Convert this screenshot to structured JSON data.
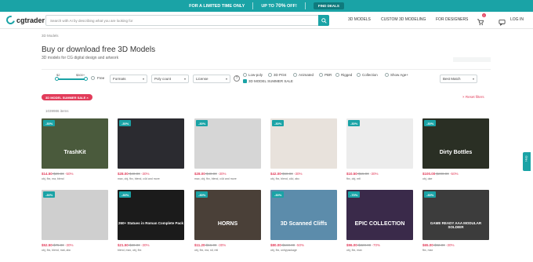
{
  "promo": {
    "limited": "FOR A LIMITED TIME ONLY",
    "upto": "UP TO",
    "pct": "70%",
    "off": "OFF!",
    "find_deals": "FIND DEALS"
  },
  "header": {
    "logo": "cgtrader",
    "search_placeholder": "Search with AI by describing what you are looking for",
    "nav": [
      "3D MODELS",
      "CUSTOM 3D MODELING",
      "FOR DESIGNERS"
    ],
    "cart_count": "0",
    "login": "LOG IN"
  },
  "breadcrumb": "3D Models",
  "title": "Buy or download free 3D Models",
  "subtitle": "3D models for CG digital design and artwork",
  "filters": {
    "price_min": "$2",
    "price_max": "$500+",
    "free": "Free",
    "formats": "Formats",
    "poly_count": "Poly count",
    "license": "License",
    "help": "?",
    "checks_row1": [
      "Low-poly",
      "3D Print",
      "Animated",
      "PBR",
      "Rigged",
      "Collection",
      "Show Age+"
    ],
    "summer_sale": "3D MODEL SUMMER SALE",
    "sort": "Best Match"
  },
  "chip": "3D MODEL SUMMER SALE ×",
  "reset": "× Reset filters",
  "count": "1039986 items",
  "colors": {
    "accent": "#1aa3a6",
    "sale": "#e23c5a"
  },
  "cards": [
    {
      "disc": "-30%",
      "title": "TrashKit",
      "price": "$14.50",
      "old": "$29.00",
      "pct": "-50%",
      "formats": "obj, fbx, ma, blend",
      "color": "#4a5a3c"
    },
    {
      "disc": "-30%",
      "title": "",
      "price": "$28.00",
      "old": "$40.00",
      "pct": "-30%",
      "formats": "max, obj, fbx, blend, c4d and more",
      "color": "#2b2b30"
    },
    {
      "disc": "-30%",
      "title": "",
      "price": "$28.00",
      "old": "$40.00",
      "pct": "-30%",
      "formats": "max, obj, fbx, blend, c4d and more",
      "color": "#d6d6d6"
    },
    {
      "disc": "-30%",
      "title": "",
      "price": "$42.00",
      "old": "$60.00",
      "pct": "-30%",
      "formats": "obj, fbx, blend, c4d, abc",
      "color": "#e8e2dc"
    },
    {
      "disc": "-30%",
      "title": "",
      "price": "$10.50",
      "old": "$15.00",
      "pct": "-30%",
      "formats": "fbx, obj, mtl",
      "color": "#ececec"
    },
    {
      "disc": "-30%",
      "title": "Dirty Bottles",
      "price": "$100.00",
      "old": "$200.00",
      "pct": "-50%",
      "formats": "obj, dae",
      "color": "#2a2f24"
    },
    {
      "disc": "-30%",
      "title": "",
      "price": "$52.50",
      "old": "$75.00",
      "pct": "-30%",
      "formats": "obj, fbx, blend, mat, abc",
      "color": "#cfcfcf"
    },
    {
      "disc": "-30%",
      "title": "260+ Statues in Roman Complete Pack",
      "price": "$21.50",
      "old": "$30.00",
      "pct": "-30%",
      "formats": "blend, max, obj, fbx",
      "color": "#1b1b1b"
    },
    {
      "disc": "-30%",
      "title": "HORNS",
      "price": "$11.20",
      "old": "$16.00",
      "pct": "-30%",
      "formats": "obj, fbx, ma, stl, mtl",
      "color": "#4a4038"
    },
    {
      "disc": "-30%",
      "title": "3D Scanned Cliffs",
      "price": "$80.00",
      "old": "$160.00",
      "pct": "-50%",
      "formats": "obj, fbx, unitypackage",
      "color": "#5c8cab"
    },
    {
      "disc": "-70%",
      "title": "EPIC COLLECTION",
      "price": "$96.00",
      "old": "$320.00",
      "pct": "-70%",
      "formats": "obj, fbx, max",
      "color": "#3a2a4a"
    },
    {
      "disc": "-30%",
      "title": "GAME READY AAA MODULAR SOLDIER",
      "price": "$65.00",
      "old": "$92.00",
      "pct": "-30%",
      "formats": "fbx, max",
      "color": "#3c3c3c"
    }
  ],
  "side_tab": "Help"
}
